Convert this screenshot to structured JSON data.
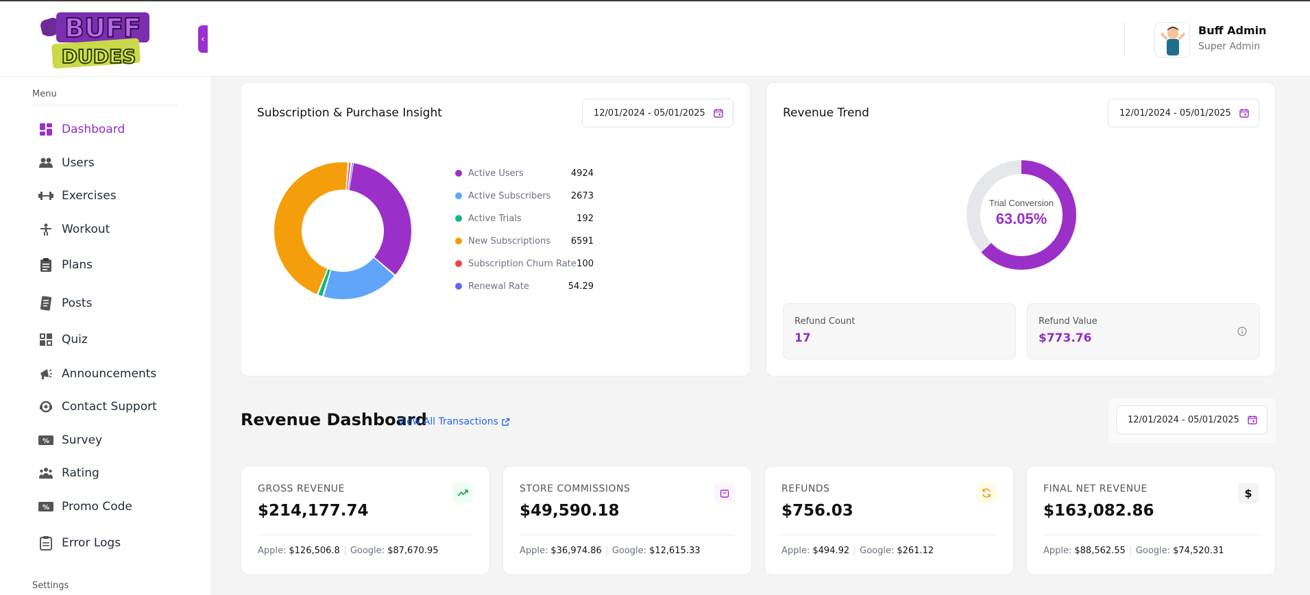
{
  "brand": {
    "logo_text_top": "BUFF",
    "logo_text_bottom": "DUDES"
  },
  "sidebar": {
    "menu_heading": "Menu",
    "settings_heading": "Settings",
    "items": [
      {
        "label": "Dashboard",
        "icon": "dashboard-icon"
      },
      {
        "label": "Users",
        "icon": "users-icon"
      },
      {
        "label": "Exercises",
        "icon": "dumbbell-icon"
      },
      {
        "label": "Workout",
        "icon": "workout-icon"
      },
      {
        "label": "Plans",
        "icon": "clipboard-icon"
      },
      {
        "label": "Posts",
        "icon": "posts-icon"
      },
      {
        "label": "Quiz",
        "icon": "quiz-icon"
      },
      {
        "label": "Announcements",
        "icon": "megaphone-icon"
      },
      {
        "label": "Contact Support",
        "icon": "support-icon"
      },
      {
        "label": "Survey",
        "icon": "survey-icon"
      },
      {
        "label": "Rating",
        "icon": "rating-icon"
      },
      {
        "label": "Promo Code",
        "icon": "promo-icon"
      },
      {
        "label": "Error Logs",
        "icon": "error-log-icon"
      }
    ]
  },
  "header": {
    "user_name": "Buff Admin",
    "user_role": "Super Admin"
  },
  "insight": {
    "title": "Subscription & Purchase Insight",
    "date_range": "12/01/2024 - 05/01/2025",
    "legend": [
      {
        "label": "Active Users",
        "value": "4924",
        "color": "#9b30c8"
      },
      {
        "label": "Active Subscribers",
        "value": "2673",
        "color": "#60a5fa"
      },
      {
        "label": "Active Trials",
        "value": "192",
        "color": "#10b981"
      },
      {
        "label": "New Subscriptions",
        "value": "6591",
        "color": "#f59e0b"
      },
      {
        "label": "Subscription Churn Rate",
        "value": "100",
        "color": "#ef4444"
      },
      {
        "label": "Renewal Rate",
        "value": "54.29",
        "color": "#6366f1"
      }
    ]
  },
  "chart_data": {
    "type": "pie",
    "categories": [
      "Active Users",
      "Active Subscribers",
      "Active Trials",
      "New Subscriptions",
      "Subscription Churn Rate",
      "Renewal Rate"
    ],
    "values": [
      4924,
      2673,
      192,
      6591,
      100,
      54.29
    ],
    "colors": [
      "#9b30c8",
      "#60a5fa",
      "#10b981",
      "#f59e0b",
      "#ef4444",
      "#6366f1"
    ],
    "donut": true,
    "legend": "right"
  },
  "revenue_trend": {
    "title": "Revenue Trend",
    "date_range": "12/01/2024 - 05/01/2025",
    "gauge_label": "Trial Conversion",
    "gauge_value": "63.05%",
    "gauge_fraction": 0.6305,
    "refund_count_label": "Refund Count",
    "refund_count": "17",
    "refund_value_label": "Refund Value",
    "refund_value": "$773.76"
  },
  "revenue_dashboard": {
    "title": "Revenue Dashboard",
    "view_all": "View All Transactions",
    "date_range": "12/01/2024 - 05/01/2025",
    "cards": [
      {
        "label": "GROSS REVENUE",
        "value": "$214,177.74",
        "apple": "$126,506.8",
        "google": "$87,670.95",
        "icon": "trend-up-icon",
        "icon_color": "#16a34a",
        "icon_bg": "#f0fdf4"
      },
      {
        "label": "STORE COMMISSIONS",
        "value": "$49,590.18",
        "apple": "$36,974.86",
        "google": "$12,615.33",
        "icon": "shopping-bag-icon",
        "icon_color": "#9b30c8",
        "icon_bg": "#faf5ff"
      },
      {
        "label": "REFUNDS",
        "value": "$756.03",
        "apple": "$494.92",
        "google": "$261.12",
        "icon": "refresh-icon",
        "icon_color": "#f59e0b",
        "icon_bg": "#fffbeb"
      },
      {
        "label": "FINAL NET REVENUE",
        "value": "$163,082.86",
        "apple": "$88,562.55",
        "google": "$74,520.31",
        "icon": "dollar-icon",
        "icon_color": "#111111",
        "icon_bg": "#f3f4f6"
      }
    ],
    "apple_label": "Apple:",
    "google_label": "Google:"
  }
}
